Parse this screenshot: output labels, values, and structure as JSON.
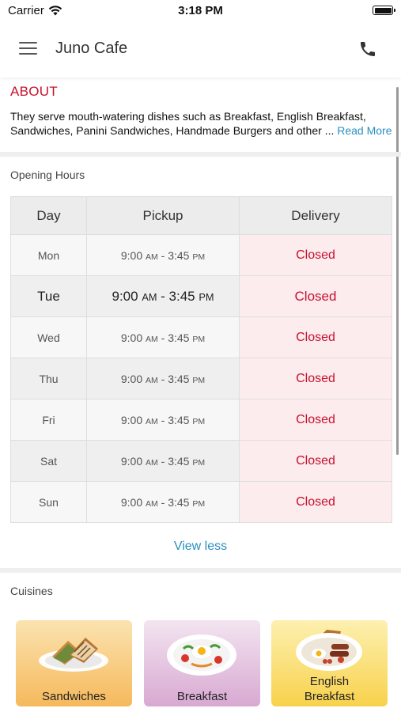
{
  "status_bar": {
    "carrier": "Carrier",
    "time": "3:18 PM"
  },
  "header": {
    "title": "Juno Cafe",
    "menu_icon": "hamburger-menu-icon",
    "call_icon": "phone-icon"
  },
  "about": {
    "title": "ABOUT",
    "text": "They serve mouth-watering dishes such as Breakfast, English Breakfast, Sandwiches, Panini Sandwiches, Handmade Burgers and other ...",
    "read_more": "Read More"
  },
  "opening_hours": {
    "title": "Opening Hours",
    "columns": [
      "Day",
      "Pickup",
      "Delivery"
    ],
    "rows": [
      {
        "day": "Mon",
        "open": "9:00",
        "open_suffix": "AM",
        "close": "3:45",
        "close_suffix": "PM",
        "delivery": "Closed"
      },
      {
        "day": "Tue",
        "open": "9:00",
        "open_suffix": "AM",
        "close": "3:45",
        "close_suffix": "PM",
        "delivery": "Closed",
        "today": true
      },
      {
        "day": "Wed",
        "open": "9:00",
        "open_suffix": "AM",
        "close": "3:45",
        "close_suffix": "PM",
        "delivery": "Closed"
      },
      {
        "day": "Thu",
        "open": "9:00",
        "open_suffix": "AM",
        "close": "3:45",
        "close_suffix": "PM",
        "delivery": "Closed"
      },
      {
        "day": "Fri",
        "open": "9:00",
        "open_suffix": "AM",
        "close": "3:45",
        "close_suffix": "PM",
        "delivery": "Closed"
      },
      {
        "day": "Sat",
        "open": "9:00",
        "open_suffix": "AM",
        "close": "3:45",
        "close_suffix": "PM",
        "delivery": "Closed"
      },
      {
        "day": "Sun",
        "open": "9:00",
        "open_suffix": "AM",
        "close": "3:45",
        "close_suffix": "PM",
        "delivery": "Closed"
      }
    ],
    "toggle_label": "View less"
  },
  "cuisines": {
    "title": "Cuisines",
    "items": [
      {
        "label": "Sandwiches",
        "bg_top": "#fbe3b0",
        "bg_bottom": "#f6b95c"
      },
      {
        "label": "Breakfast",
        "bg_top": "#f3e4f0",
        "bg_bottom": "#d8a9d2"
      },
      {
        "label": "English Breakfast",
        "label_line1": "English",
        "label_line2": "Breakfast",
        "bg_top": "#fdf0b0",
        "bg_bottom": "#f8d24c"
      }
    ]
  },
  "colors": {
    "accent_red": "#c8102e",
    "link_blue": "#2a8fc0",
    "closed_bg": "#fcecee"
  }
}
